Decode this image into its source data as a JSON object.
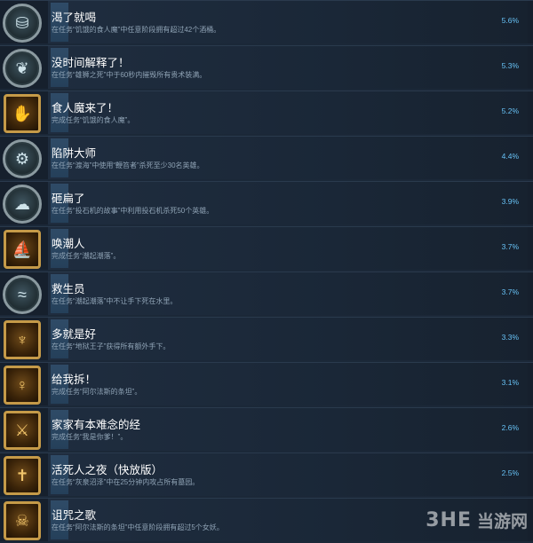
{
  "achievements": [
    {
      "title": "渴了就喝",
      "desc": "在任务“饥饿的食人魔”中任意阶段拥有超过42个酒桶。",
      "percent": "5.6%",
      "icon": "barrels-icon",
      "frame": "round"
    },
    {
      "title": "没时间解释了！",
      "desc": "在任务“雄狮之死”中于60秒内摧毁所有贵术装满。",
      "percent": "5.3%",
      "icon": "rabbit-icon",
      "frame": "round"
    },
    {
      "title": "食人魔来了！",
      "desc": "完成任务“饥饿的食人魔”。",
      "percent": "5.2%",
      "icon": "ogre-hand-icon",
      "frame": "gold"
    },
    {
      "title": "陷阱大师",
      "desc": "在任务“渡海”中使用“鞭笞者”杀死至少30名英雄。",
      "percent": "4.4%",
      "icon": "trap-icon",
      "frame": "round"
    },
    {
      "title": "砸扁了",
      "desc": "在任务“投石机的故事”中利用投石机杀死50个英雄。",
      "percent": "3.9%",
      "icon": "boulder-icon",
      "frame": "round"
    },
    {
      "title": "唤潮人",
      "desc": "完成任务“潮起潮落”。",
      "percent": "3.7%",
      "icon": "ship-icon",
      "frame": "gold"
    },
    {
      "title": "救生员",
      "desc": "在任务“潮起潮落”中不让手下死在水里。",
      "percent": "3.7%",
      "icon": "water-icon",
      "frame": "round"
    },
    {
      "title": "多就是好",
      "desc": "在任务“地狱王子”获得所有额外手下。",
      "percent": "3.3%",
      "icon": "horned-demon-icon",
      "frame": "gold"
    },
    {
      "title": "给我拆！",
      "desc": "完成任务“阿尔法斯的条坦”。",
      "percent": "3.1%",
      "icon": "sorceress-icon",
      "frame": "gold"
    },
    {
      "title": "家家有本难念的经",
      "desc": "完成任务“我是你爹！”。",
      "percent": "2.6%",
      "icon": "warrior-icon",
      "frame": "gold"
    },
    {
      "title": "活死人之夜（快放版）",
      "desc": "在任务“灰泉沼泽”中在25分钟内攻占所有墓园。",
      "percent": "2.5%",
      "icon": "tombstone-icon",
      "frame": "gold"
    },
    {
      "title": "诅咒之歌",
      "desc": "在任务“阿尔法斯的条坦”中任意阶段拥有超过5个女妖。",
      "percent": "",
      "icon": "banshee-icon",
      "frame": "gold"
    }
  ],
  "watermark": {
    "brand": "3HE",
    "site": "当游网"
  },
  "glyphs": {
    "barrels-icon": "⛁",
    "rabbit-icon": "❦",
    "ogre-hand-icon": "✋",
    "trap-icon": "⚙",
    "boulder-icon": "☁",
    "ship-icon": "⛵",
    "water-icon": "≈",
    "horned-demon-icon": "♆",
    "sorceress-icon": "♀",
    "warrior-icon": "⚔",
    "tombstone-icon": "✝",
    "banshee-icon": "☠"
  }
}
